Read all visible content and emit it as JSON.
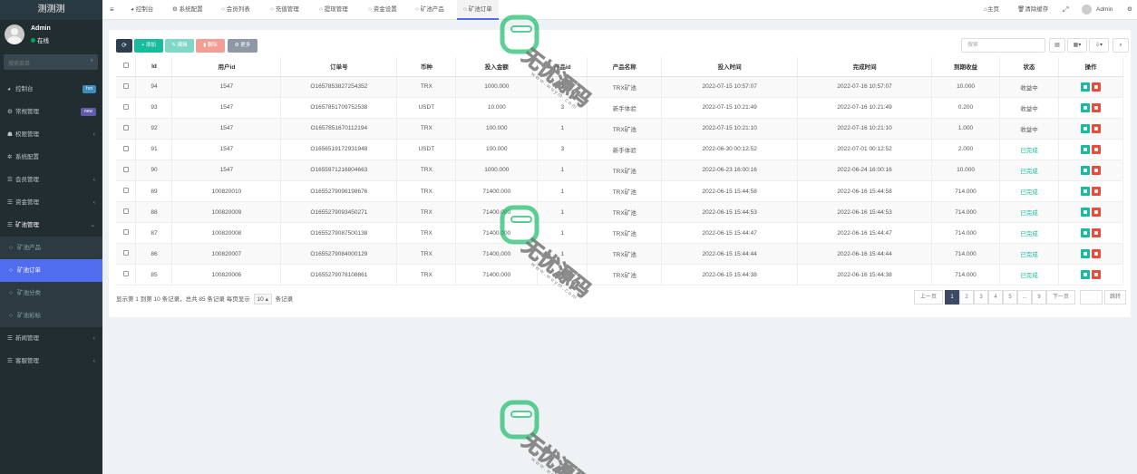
{
  "sidebar": {
    "logo": "测测测",
    "user_name": "Admin",
    "user_status": "在线",
    "search_placeholder": "搜索菜单",
    "items": [
      {
        "label": "控制台",
        "icon": "dashboard-icon",
        "badge": "hot",
        "badge_color": "#3c8dbc"
      },
      {
        "label": "常规管理",
        "icon": "cogs-icon",
        "badge": "new",
        "badge_color": "#605ca8"
      },
      {
        "label": "权限管理",
        "icon": "group-icon"
      },
      {
        "label": "系统配置",
        "icon": "gear-icon"
      },
      {
        "label": "会员管理",
        "icon": "list-icon"
      },
      {
        "label": "资金管理",
        "icon": "list-icon"
      },
      {
        "label": "矿池管理",
        "icon": "list-icon"
      }
    ],
    "sub_items": [
      "矿池产品",
      "矿池订单",
      "矿池分类",
      "矿池彩标"
    ],
    "active_sub": "矿池订单",
    "bottom_items": [
      {
        "label": "新闻管理",
        "icon": "list-icon"
      },
      {
        "label": "客服管理",
        "icon": "list-icon"
      }
    ]
  },
  "topbar": {
    "tabs": [
      "控制台",
      "系统配置",
      "会员列表",
      "充值管理",
      "提现管理",
      "资金设置",
      "矿池产品",
      "矿池订单"
    ],
    "active_tab": "矿池订单",
    "home": "主页",
    "clear_cache": "清除缓存",
    "admin": "Admin"
  },
  "toolbar": {
    "add": "添加",
    "edit": "编辑",
    "delete": "删除",
    "more": "更多",
    "search_placeholder": "搜索"
  },
  "table": {
    "columns": [
      "Id",
      "用户id",
      "订单号",
      "币种",
      "投入金额",
      "产品id",
      "产品名称",
      "投入时间",
      "完成时间",
      "到期收益",
      "状态",
      "操作"
    ],
    "rows": [
      [
        "94",
        "1547",
        "O1657853827254352",
        "TRX",
        "1000.000",
        "1",
        "TRX矿池",
        "2022-07-15 10:57:07",
        "2022-07-16 10:57:07",
        "10.000",
        "收益中"
      ],
      [
        "93",
        "1547",
        "O1657851709752538",
        "USDT",
        "10.000",
        "3",
        "新手体验",
        "2022-07-15 10:21:49",
        "2022-07-16 10:21:49",
        "0.200",
        "收益中"
      ],
      [
        "92",
        "1547",
        "O1657851670112194",
        "TRX",
        "100.000",
        "1",
        "TRX矿池",
        "2022-07-15 10:21:10",
        "2022-07-16 10:21:10",
        "1.000",
        "收益中"
      ],
      [
        "91",
        "1547",
        "O1656519172931948",
        "USDT",
        "100.000",
        "3",
        "新手体验",
        "2022-06-30 00:12:52",
        "2022-07-01 00:12:52",
        "2.000",
        "已完成"
      ],
      [
        "90",
        "1547",
        "O1655971216804663",
        "TRX",
        "1000.000",
        "1",
        "TRX矿池",
        "2022-06-23 16:00:16",
        "2022-06-24 16:00:16",
        "10.000",
        "已完成"
      ],
      [
        "89",
        "100820010",
        "O1655279098198676",
        "TRX",
        "71400.000",
        "1",
        "TRX矿池",
        "2022-06-15 15:44:58",
        "2022-06-16 15:44:58",
        "714.000",
        "已完成"
      ],
      [
        "88",
        "100820009",
        "O1655279093450271",
        "TRX",
        "71400.000",
        "1",
        "TRX矿池",
        "2022-06-15 15:44:53",
        "2022-06-16 15:44:53",
        "714.000",
        "已完成"
      ],
      [
        "87",
        "100820008",
        "O1655279087500138",
        "TRX",
        "71400.000",
        "1",
        "TRX矿池",
        "2022-06-15 15:44:47",
        "2022-06-16 15:44:47",
        "714.000",
        "已完成"
      ],
      [
        "86",
        "100820007",
        "O1655279084000129",
        "TRX",
        "71400.000",
        "1",
        "TRX矿池",
        "2022-06-15 15:44:44",
        "2022-06-16 15:44:44",
        "714.000",
        "已完成"
      ],
      [
        "85",
        "100820006",
        "O1655279078108861",
        "TRX",
        "71400.000",
        "1",
        "TRX矿池",
        "2022-06-15 15:44:38",
        "2022-06-16 15:44:38",
        "714.000",
        "已完成"
      ]
    ]
  },
  "footer": {
    "summary": "显示第 1 到第 10 条记录，总共 85 条记录 每页显示",
    "page_size": "10",
    "suffix": "条记录"
  },
  "pagination": {
    "prev": "上一页",
    "pages": [
      "1",
      "2",
      "3",
      "4",
      "5",
      "...",
      "9"
    ],
    "current": "1",
    "next": "下一页",
    "jump": "跳转"
  },
  "watermark": {
    "text": "无忧源码",
    "url": "w w w . w u y m . c o m",
    "color": "#18bc6a"
  }
}
